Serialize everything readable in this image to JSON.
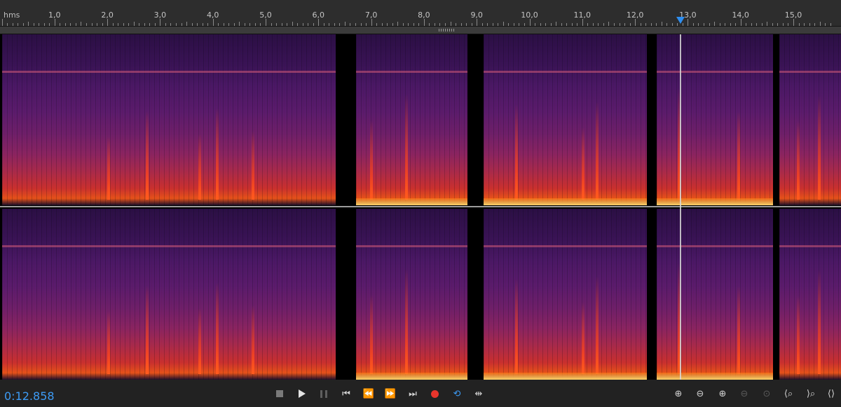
{
  "ruler": {
    "unit_label": "hms",
    "tick_labels": [
      "1,0",
      "2,0",
      "3,0",
      "4,0",
      "5,0",
      "6,0",
      "7,0",
      "8,0",
      "9,0",
      "10,0",
      "11,0",
      "12,0",
      "13,0",
      "14,0",
      "15,0"
    ]
  },
  "playhead": {
    "time_seconds": 12.858,
    "color": "#2e8ef0"
  },
  "spectral_display": {
    "channels": [
      "channel-1",
      "channel-2"
    ],
    "colormap": [
      "#2b0f45",
      "#5a1b6c",
      "#a82a4c",
      "#e5521a",
      "#ffd36a"
    ]
  },
  "transport": {
    "time_display": "0:12.858",
    "time_color": "#3d9bf5",
    "buttons": [
      "stop-icon",
      "play-icon",
      "pause-icon",
      "go-to-start-icon",
      "rewind-icon",
      "fast-forward-icon",
      "go-to-end-icon",
      "record-icon",
      "loop-icon",
      "skip-selection-icon"
    ],
    "zoom_buttons": [
      "zoom-in-amplitude-icon",
      "zoom-out-amplitude-icon",
      "zoom-in-time-icon",
      "zoom-out-time-icon",
      "zoom-reset-icon",
      "zoom-in-point-icon",
      "zoom-out-full-icon",
      "zoom-to-selection-icon"
    ]
  }
}
